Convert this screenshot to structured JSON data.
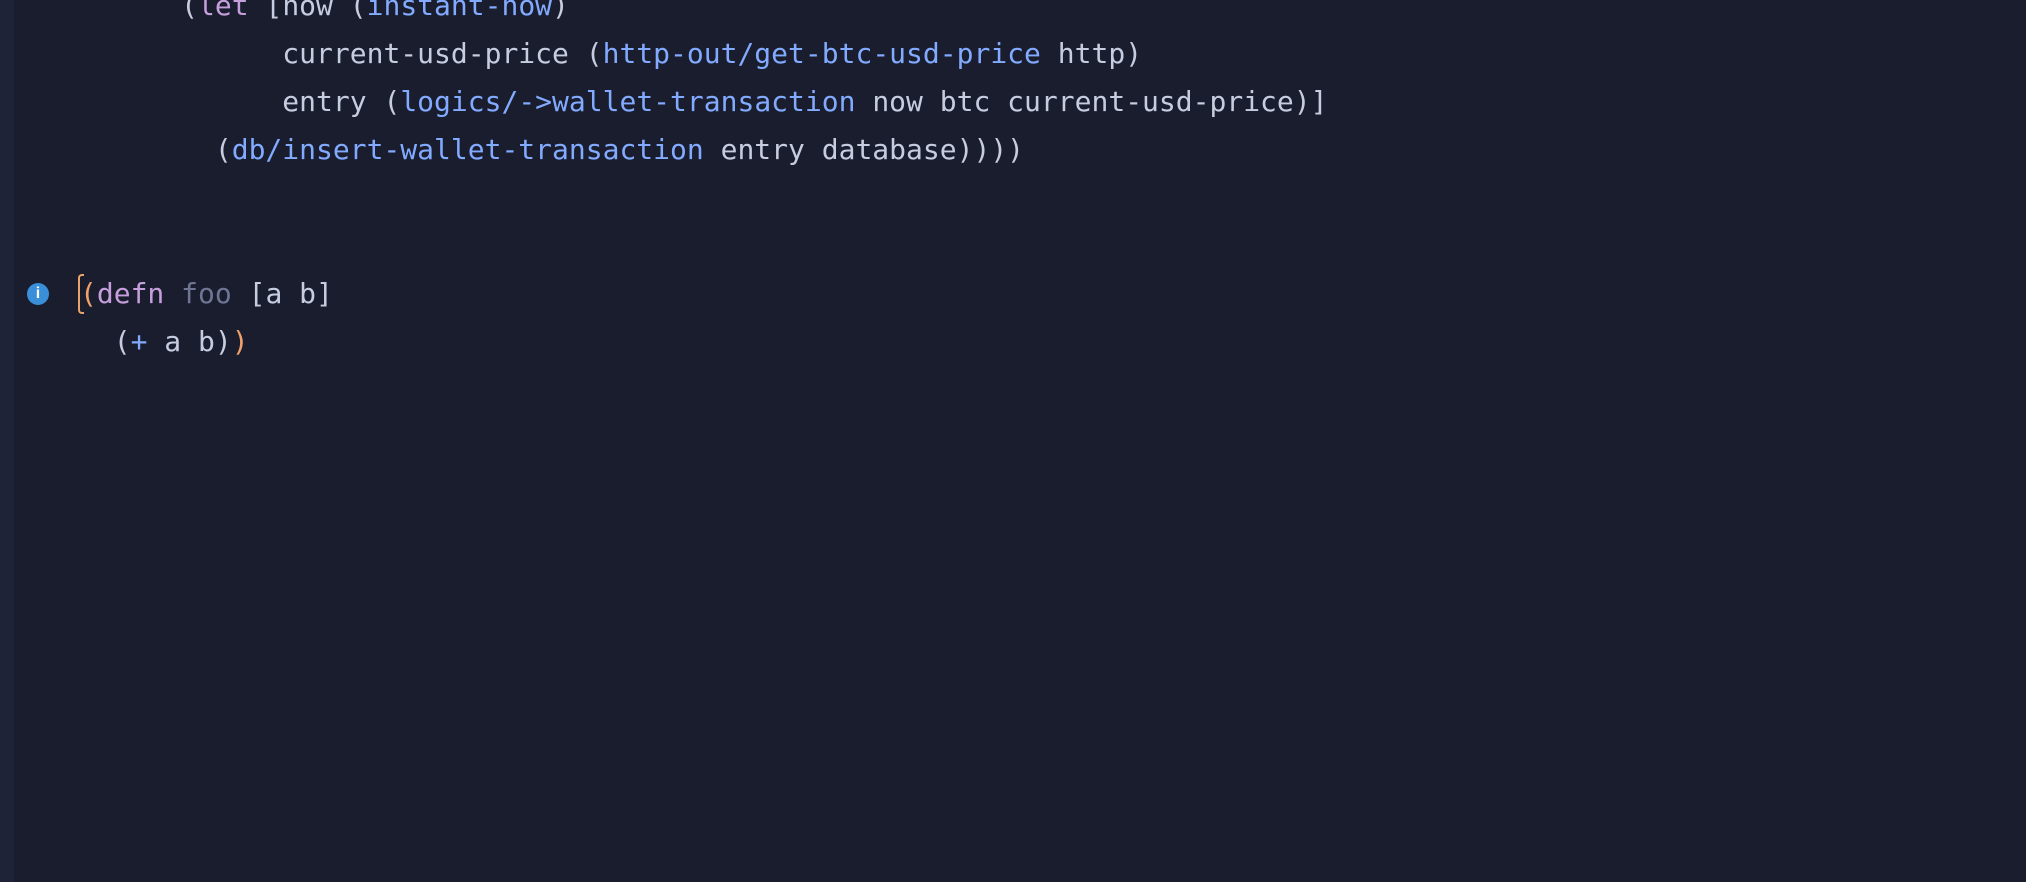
{
  "colors": {
    "background": "#191d2e",
    "strip": "#1f2338",
    "text": "#c7cde0",
    "keyword": "#c69edb",
    "function": "#82aaff",
    "dim": "#6f7694",
    "highlightParen": "#f0a06a",
    "infoIcon": "#3a8fd9"
  },
  "gutter": {
    "icons": [
      {
        "line": 6,
        "type": "info",
        "glyph": "i"
      }
    ]
  },
  "code": {
    "lines": [
      {
        "indent": "      ",
        "tokens": [
          {
            "t": "(",
            "c": "paren"
          },
          {
            "t": "let",
            "c": "keyword"
          },
          {
            "t": " ",
            "c": "sym"
          },
          {
            "t": "[",
            "c": "bracket"
          },
          {
            "t": "now ",
            "c": "sym"
          },
          {
            "t": "(",
            "c": "paren"
          },
          {
            "t": "instant-now",
            "c": "fn"
          },
          {
            "t": ")",
            "c": "paren"
          }
        ]
      },
      {
        "indent": "            ",
        "tokens": [
          {
            "t": "current-usd-price ",
            "c": "sym"
          },
          {
            "t": "(",
            "c": "paren"
          },
          {
            "t": "http-out/get-btc-usd-price",
            "c": "fn"
          },
          {
            "t": " http",
            "c": "sym"
          },
          {
            "t": ")",
            "c": "paren"
          }
        ]
      },
      {
        "indent": "            ",
        "tokens": [
          {
            "t": "entry ",
            "c": "sym"
          },
          {
            "t": "(",
            "c": "paren"
          },
          {
            "t": "logics/->wallet-transaction",
            "c": "fn"
          },
          {
            "t": " now btc current-usd-price",
            "c": "sym"
          },
          {
            "t": ")",
            "c": "paren"
          },
          {
            "t": "]",
            "c": "bracket"
          }
        ]
      },
      {
        "indent": "        ",
        "tokens": [
          {
            "t": "(",
            "c": "paren"
          },
          {
            "t": "db/insert-wallet-transaction",
            "c": "fn"
          },
          {
            "t": " entry database",
            "c": "sym"
          },
          {
            "t": "))))",
            "c": "paren"
          }
        ]
      },
      {
        "indent": "",
        "tokens": []
      },
      {
        "indent": "",
        "tokens": []
      },
      {
        "indent": "",
        "tokens": [
          {
            "t": "(",
            "c": "hlparen",
            "cursor": true
          },
          {
            "t": "defn",
            "c": "keyword"
          },
          {
            "t": " ",
            "c": "sym"
          },
          {
            "t": "foo",
            "c": "dim"
          },
          {
            "t": " ",
            "c": "sym"
          },
          {
            "t": "[",
            "c": "bracket"
          },
          {
            "t": "a b",
            "c": "sym"
          },
          {
            "t": "]",
            "c": "bracket"
          }
        ]
      },
      {
        "indent": "  ",
        "tokens": [
          {
            "t": "(",
            "c": "paren"
          },
          {
            "t": "+",
            "c": "fn"
          },
          {
            "t": " a b",
            "c": "sym"
          },
          {
            "t": ")",
            "c": "paren"
          },
          {
            "t": ")",
            "c": "hlparen"
          }
        ]
      }
    ]
  }
}
